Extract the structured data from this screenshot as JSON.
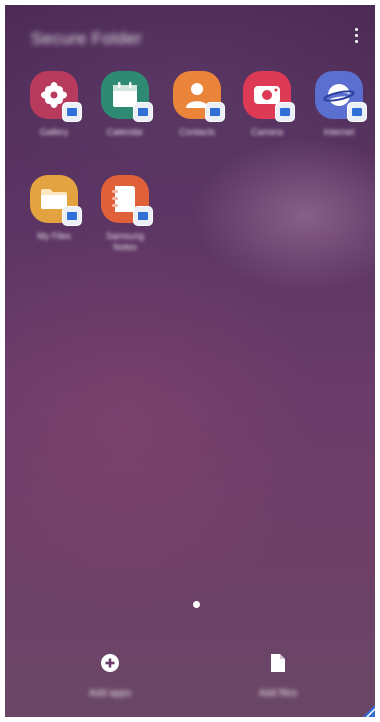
{
  "header": {
    "title": "Secure Folder"
  },
  "apps": [
    {
      "label": "Gallery",
      "icon": "gallery-icon",
      "color": "#b83a5c"
    },
    {
      "label": "Calendar",
      "icon": "calendar-icon",
      "color": "#2f8a73"
    },
    {
      "label": "Contacts",
      "icon": "contacts-icon",
      "color": "#e9843a"
    },
    {
      "label": "Camera",
      "icon": "camera-icon",
      "color": "#dd3a55"
    },
    {
      "label": "Internet",
      "icon": "internet-icon",
      "color": "#5a6fd0"
    },
    {
      "label": "My Files",
      "icon": "folder-icon",
      "color": "#e3a340"
    },
    {
      "label": "Samsung Notes",
      "icon": "notes-icon",
      "color": "#e0603a"
    }
  ],
  "bottom_bar": {
    "add_apps_label": "Add apps",
    "add_files_label": "Add files"
  },
  "colors": {
    "badge": "#2f6fd6",
    "text": "#ffffff"
  }
}
